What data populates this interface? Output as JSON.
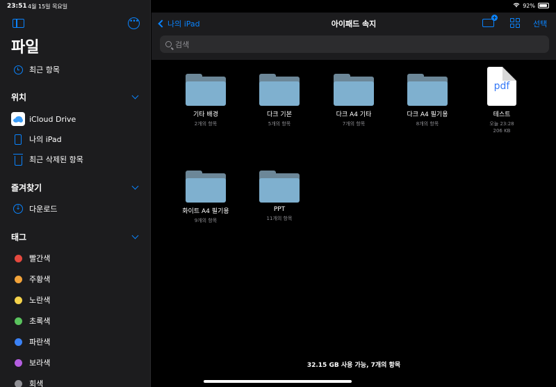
{
  "status": {
    "time": "23:51",
    "date": "4월 15일 목요일",
    "battery": "92%"
  },
  "sidebar": {
    "title": "파일",
    "recents": "최근 항목",
    "locations_header": "위치",
    "locations": [
      "iCloud Drive",
      "나의 iPad",
      "최근 삭제된 항목"
    ],
    "favorites_header": "즐겨찾기",
    "favorites": [
      "다운로드"
    ],
    "tags_header": "태그",
    "tags": [
      {
        "label": "빨간색",
        "color": "#e5493f"
      },
      {
        "label": "주황색",
        "color": "#f2a33a"
      },
      {
        "label": "노란색",
        "color": "#f5d34b"
      },
      {
        "label": "초록색",
        "color": "#5ac35e"
      },
      {
        "label": "파란색",
        "color": "#3b82f6"
      },
      {
        "label": "보라색",
        "color": "#b45ee0"
      },
      {
        "label": "회색",
        "color": "#8e8e93"
      }
    ]
  },
  "nav": {
    "back_label": "나의 iPad",
    "title": "아이패드 속지",
    "select_label": "선택",
    "search_placeholder": "검색"
  },
  "items": [
    {
      "name": "기타 배경",
      "sub": "2개의 항목"
    },
    {
      "name": "다크 기본",
      "sub": "5개의 항목"
    },
    {
      "name": "다크 A4 기타",
      "sub": "7개의 항목"
    },
    {
      "name": "다크 A4 필기용",
      "sub": "8개의 항목"
    },
    {
      "name": "테스트",
      "sub": "오늘 23:28",
      "size": "206 KB",
      "icon_text": "pdf"
    },
    {
      "name": "화이트 A4 필기용",
      "sub": "9개의 항목"
    },
    {
      "name": "PPT",
      "sub": "11개의 항목"
    }
  ],
  "footer": "32.15 GB 사용 가능, 7개의 항목",
  "colors": {
    "accent": "#0a84ff",
    "folder": "#7fb0cf"
  }
}
